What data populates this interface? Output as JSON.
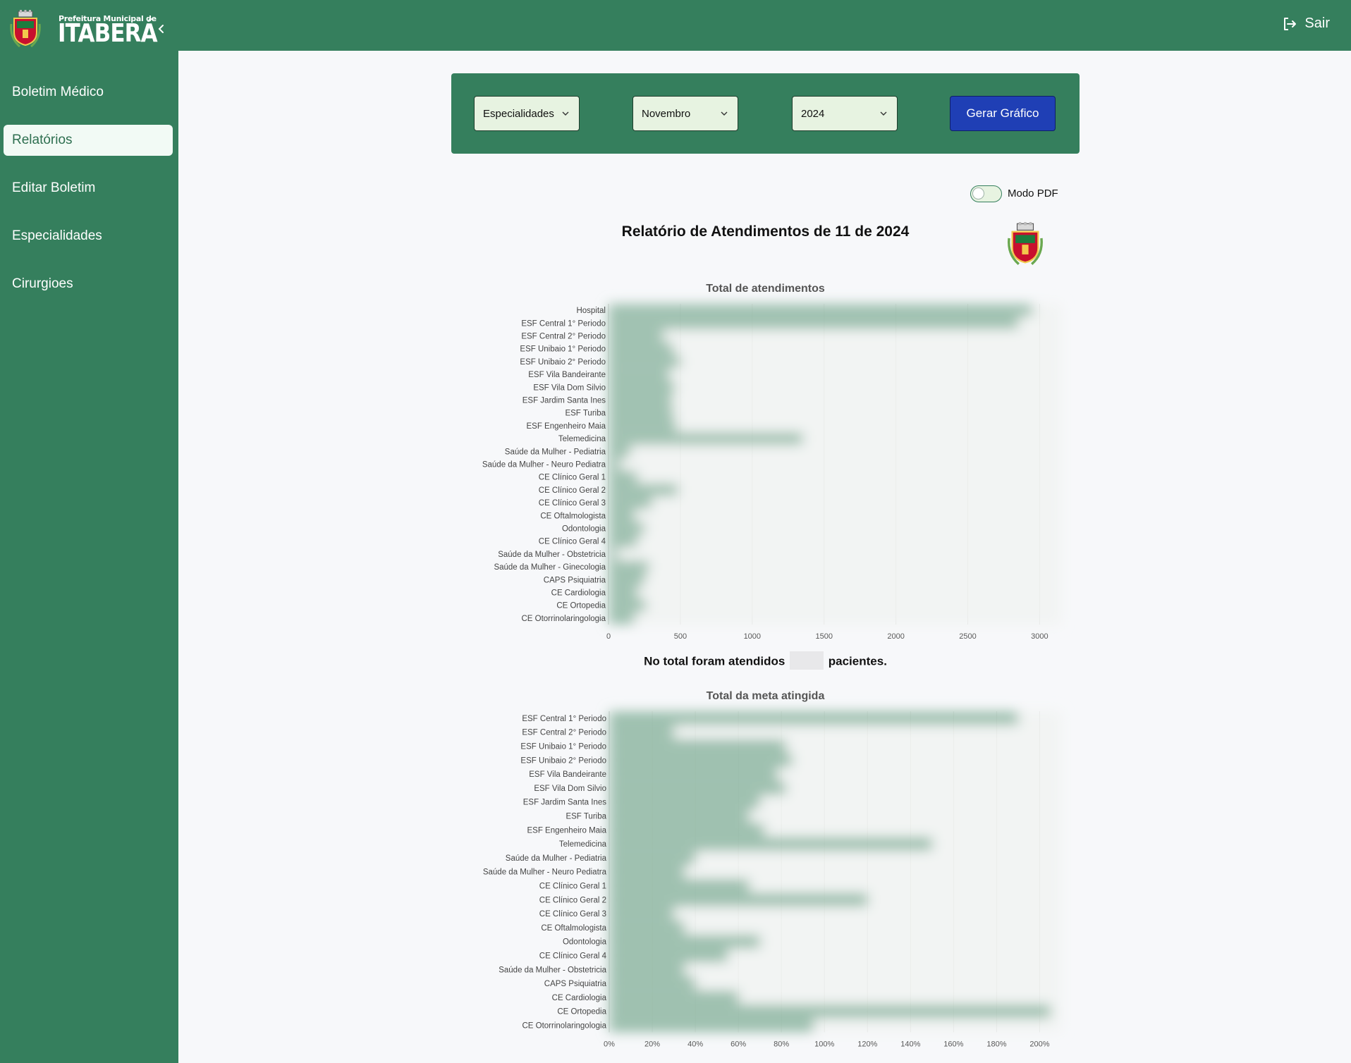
{
  "header": {
    "logo_small": "Prefeitura Municipal de",
    "logo_big": "ITABERÁ",
    "logout_label": "Sair"
  },
  "sidebar": {
    "items": [
      {
        "label": "Boletim Médico",
        "active": false
      },
      {
        "label": "Relatórios",
        "active": true
      },
      {
        "label": "Editar Boletim",
        "active": false
      },
      {
        "label": "Especialidades",
        "active": false
      },
      {
        "label": "Cirurgioes",
        "active": false
      }
    ]
  },
  "filters": {
    "category": "Especialidades",
    "month": "Novembro",
    "year": "2024",
    "generate_label": "Gerar Gráfico"
  },
  "pdf_toggle": {
    "label": "Modo PDF",
    "on": false
  },
  "report": {
    "title": "Relatório de Atendimentos de 11 de 2024",
    "total_prefix": "No total foram atendidos",
    "total_suffix": "pacientes."
  },
  "colors": {
    "brand": "#357f5d",
    "button": "#1f3fb5",
    "bar": "#5b9c7c"
  },
  "chart_data": [
    {
      "type": "bar",
      "orientation": "horizontal",
      "title": "Total de atendimentos",
      "categories": [
        "Hospital",
        "ESF Central 1° Periodo",
        "ESF Central 2° Periodo",
        "ESF Unibaio 1° Periodo",
        "ESF Unibaio 2° Periodo",
        "ESF Vila Bandeirante",
        "ESF Vila Dom Silvio",
        "ESF Jardim Santa Ines",
        "ESF Turiba",
        "ESF Engenheiro Maia",
        "Telemedicina",
        "Saúde da Mulher - Pediatria",
        "Saúde da Mulher - Neuro Pediatra",
        "CE Clínico Geral 1",
        "CE Clínico Geral 2",
        "CE Clínico Geral 3",
        "CE Oftalmologista",
        "Odontologia",
        "CE Clínico Geral 4",
        "Saúde da Mulher - Obstetricia",
        "Saúde da Mulher - Ginecologia",
        "CAPS Psiquiatria",
        "CE Cardiologia",
        "CE Ortopedia",
        "CE Otorrinolaringologia"
      ],
      "values": [
        2950,
        2850,
        380,
        450,
        500,
        420,
        460,
        440,
        450,
        470,
        1350,
        150,
        80,
        200,
        480,
        300,
        180,
        250,
        200,
        60,
        280,
        250,
        200,
        260,
        180
      ],
      "xticks": [
        "0",
        "500",
        "1000",
        "1500",
        "2000",
        "2500",
        "3000"
      ],
      "xlim": [
        0,
        3150
      ],
      "obscured": true
    },
    {
      "type": "bar",
      "orientation": "horizontal",
      "title": "Total da meta atingida",
      "categories": [
        "ESF Central 1° Periodo",
        "ESF Central 2° Periodo",
        "ESF Unibaio 1° Periodo",
        "ESF Unibaio 2° Periodo",
        "ESF Vila Bandeirante",
        "ESF Vila Dom Silvio",
        "ESF Jardim Santa Ines",
        "ESF Turiba",
        "ESF Engenheiro Maia",
        "Telemedicina",
        "Saúde da Mulher - Pediatria",
        "Saúde da Mulher - Neuro Pediatra",
        "CE Clínico Geral 1",
        "CE Clínico Geral 2",
        "CE Clínico Geral 3",
        "CE Oftalmologista",
        "Odontologia",
        "CE Clínico Geral 4",
        "Saúde da Mulher - Obstetricia",
        "CAPS Psiquiatria",
        "CE Cardiologia",
        "CE Ortopedia",
        "CE Otorrinolaringologia"
      ],
      "values": [
        190,
        30,
        82,
        85,
        78,
        82,
        70,
        65,
        72,
        150,
        40,
        35,
        65,
        120,
        30,
        35,
        70,
        55,
        35,
        40,
        60,
        205,
        95
      ],
      "xticks": [
        "0%",
        "20%",
        "40%",
        "60%",
        "80%",
        "100%",
        "120%",
        "140%",
        "160%",
        "180%",
        "200%"
      ],
      "xlim": [
        0,
        210
      ],
      "obscured": true
    }
  ]
}
